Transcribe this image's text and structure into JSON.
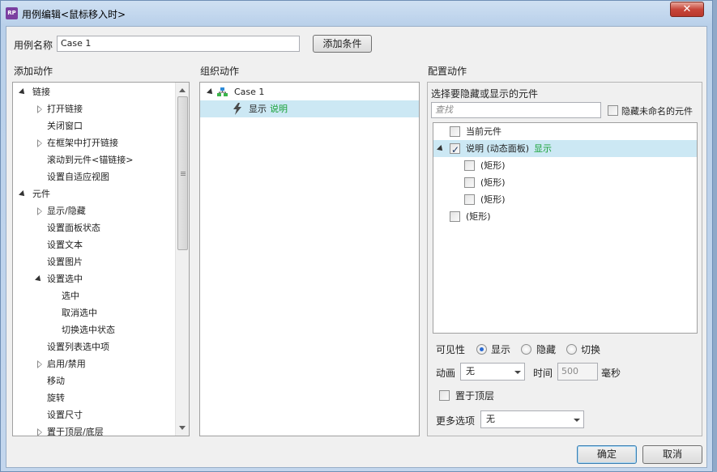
{
  "window": {
    "title": "用例编辑<鼠标移入时>",
    "app_icon": "RP",
    "close": "✕"
  },
  "case_name": {
    "label": "用例名称",
    "value": "Case 1",
    "add_condition": "添加条件"
  },
  "add_actions": {
    "header": "添加动作",
    "items": [
      {
        "label": "链接",
        "level": 0,
        "expander": "open"
      },
      {
        "label": "打开链接",
        "level": 1,
        "expander": "closed"
      },
      {
        "label": "关闭窗口",
        "level": 1,
        "expander": "none"
      },
      {
        "label": "在框架中打开链接",
        "level": 1,
        "expander": "closed"
      },
      {
        "label": "滚动到元件<锚链接>",
        "level": 1,
        "expander": "none"
      },
      {
        "label": "设置自适应视图",
        "level": 1,
        "expander": "none"
      },
      {
        "label": "元件",
        "level": 0,
        "expander": "open"
      },
      {
        "label": "显示/隐藏",
        "level": 1,
        "expander": "closed"
      },
      {
        "label": "设置面板状态",
        "level": 1,
        "expander": "none"
      },
      {
        "label": "设置文本",
        "level": 1,
        "expander": "none"
      },
      {
        "label": "设置图片",
        "level": 1,
        "expander": "none"
      },
      {
        "label": "设置选中",
        "level": 1,
        "expander": "open"
      },
      {
        "label": "选中",
        "level": 2,
        "expander": "none"
      },
      {
        "label": "取消选中",
        "level": 2,
        "expander": "none"
      },
      {
        "label": "切换选中状态",
        "level": 2,
        "expander": "none"
      },
      {
        "label": "设置列表选中项",
        "level": 1,
        "expander": "none"
      },
      {
        "label": "启用/禁用",
        "level": 1,
        "expander": "closed"
      },
      {
        "label": "移动",
        "level": 1,
        "expander": "none"
      },
      {
        "label": "旋转",
        "level": 1,
        "expander": "none"
      },
      {
        "label": "设置尺寸",
        "level": 1,
        "expander": "none"
      },
      {
        "label": "置于顶层/底层",
        "level": 1,
        "expander": "closed"
      }
    ]
  },
  "organize_actions": {
    "header": "组织动作",
    "case_label": "Case 1",
    "action_verb": "显示",
    "action_target": "说明"
  },
  "configure_actions": {
    "header": "配置动作",
    "subheader": "选择要隐藏或显示的元件",
    "search_placeholder": "查找",
    "hide_unnamed_label": "隐藏未命名的元件",
    "widgets": [
      {
        "label": "当前元件",
        "indent": 1,
        "checked": false,
        "status": ""
      },
      {
        "label": "说明 (动态面板)",
        "indent": 1,
        "checked": true,
        "status": "显示",
        "expander": "open"
      },
      {
        "label": "(矩形)",
        "indent": 2,
        "checked": false,
        "status": ""
      },
      {
        "label": "(矩形)",
        "indent": 2,
        "checked": false,
        "status": ""
      },
      {
        "label": "(矩形)",
        "indent": 2,
        "checked": false,
        "status": ""
      },
      {
        "label": "(矩形)",
        "indent": 0,
        "checked": false,
        "status": ""
      }
    ],
    "visibility": {
      "label": "可见性",
      "options": [
        "显示",
        "隐藏",
        "切换"
      ],
      "selected": "显示"
    },
    "animation": {
      "label": "动画",
      "value": "无",
      "time_label": "时间",
      "time_value": "500",
      "unit": "毫秒"
    },
    "bring_to_front": {
      "label": "置于顶层",
      "checked": false
    },
    "more_options": {
      "label": "更多选项",
      "value": "无"
    }
  },
  "footer": {
    "ok": "确定",
    "cancel": "取消"
  }
}
